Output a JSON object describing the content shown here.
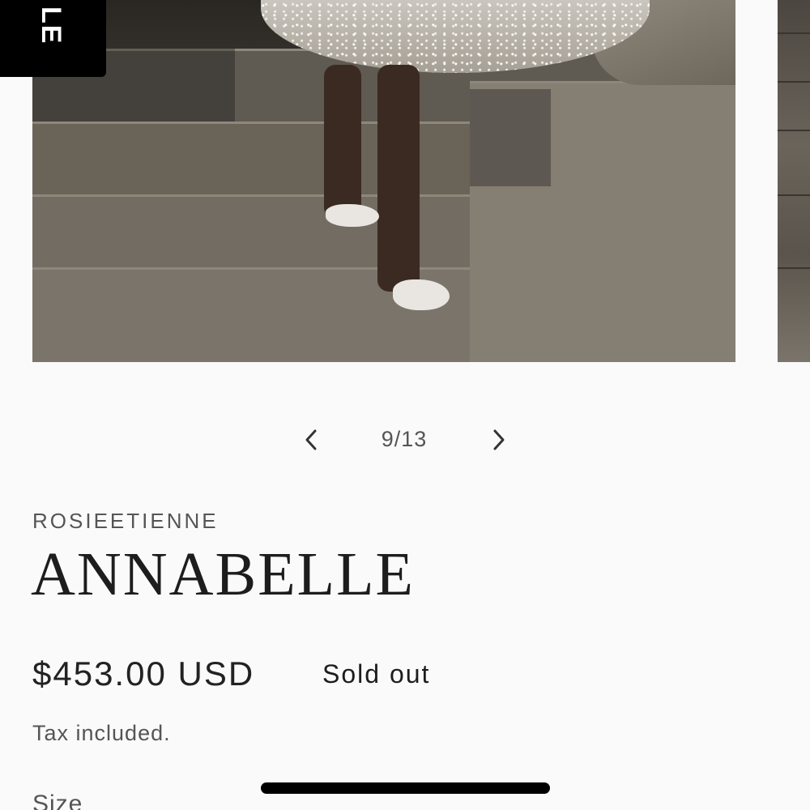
{
  "gallery": {
    "badge_text": "LE",
    "current": 9,
    "total": 13,
    "counter_label": "9/13"
  },
  "product": {
    "vendor": "ROSIEETIENNE",
    "title": "ANNABELLE",
    "price": "$453.00 USD",
    "status_badge": "Sold out",
    "tax_note": "Tax included.",
    "size_label": "Size"
  },
  "icons": {
    "prev": "chevron-left-icon",
    "next": "chevron-right-icon"
  },
  "colors": {
    "background": "#fafafa",
    "text": "#121212",
    "muted": "#555555",
    "badge": "#000000"
  }
}
